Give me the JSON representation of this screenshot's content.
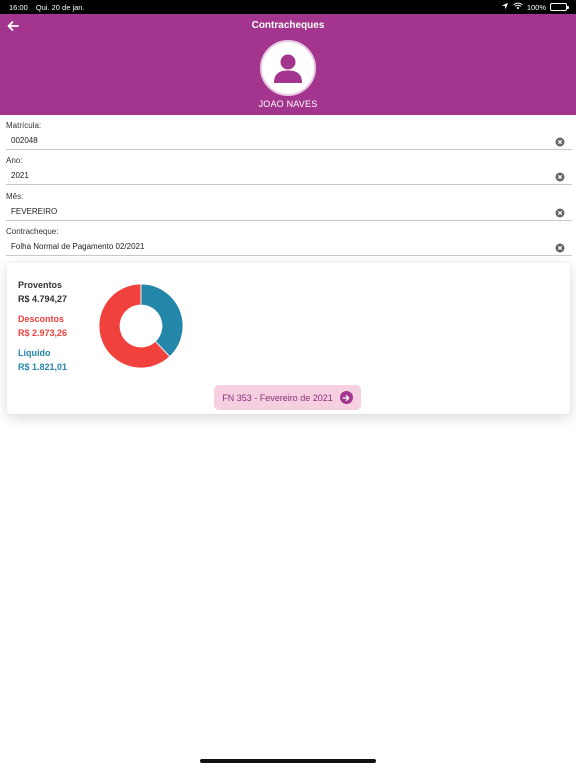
{
  "status_bar": {
    "time": "16:00",
    "date": "Qui. 20 de jan.",
    "battery": "100%",
    "battery_level": 1.0
  },
  "header": {
    "title": "Contracheques",
    "user_name": "JOAO NAVES"
  },
  "fields": [
    {
      "label": "Matrícula:",
      "value": "002048"
    },
    {
      "label": "Ano:",
      "value": "2021"
    },
    {
      "label": "Mês:",
      "value": "FEVEREIRO"
    },
    {
      "label": "Contracheque:",
      "value": "Folha Normal de Pagamento 02/2021"
    }
  ],
  "summary": {
    "proventos_label": "Proventos",
    "proventos_value": "R$ 4.794,27",
    "descontos_label": "Descontos",
    "descontos_value": "R$ 2.973,26",
    "liquido_label": "Líquido",
    "liquido_value": "R$ 1.821,01"
  },
  "chart_data": {
    "type": "pie",
    "categories": [
      "Descontos",
      "Líquido"
    ],
    "values": [
      2973.26,
      1821.01
    ],
    "colors": [
      "#f0413d",
      "#2486a8"
    ]
  },
  "document_button": {
    "label": "FN 353 - Fevereiro de 2021"
  },
  "colors": {
    "header": "#a3358f",
    "proventos": "#333333",
    "descontos": "#f0413d",
    "liquido": "#2486a8",
    "button_bg": "#f6cfe0"
  }
}
